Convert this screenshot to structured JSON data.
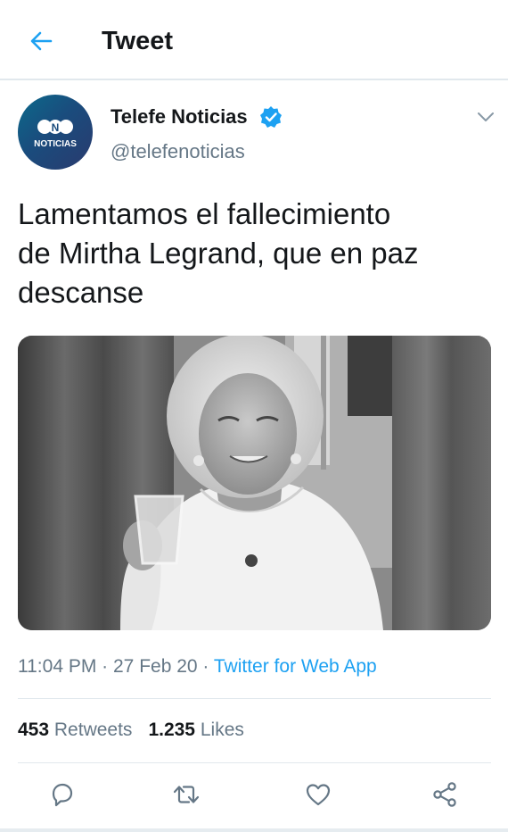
{
  "header": {
    "title": "Tweet",
    "back_icon": "arrow-left-icon",
    "accent_color": "#1da1f2"
  },
  "author": {
    "name": "Telefe Noticias",
    "handle": "@telefenoticias",
    "avatar_label": "NOTICIAS",
    "avatar_mark": "N",
    "verified": true
  },
  "tweet": {
    "text_lines": [
      "Lamentamos el fallecimiento",
      "de Mirtha Legrand, que en paz",
      "descanse"
    ]
  },
  "meta": {
    "time": "11:04 PM",
    "separator": " · ",
    "date": "27 Feb 20",
    "source": "Twitter for Web App"
  },
  "stats": {
    "retweets_count": "453",
    "retweets_label": "Retweets",
    "likes_count": "1.235",
    "likes_label": "Likes"
  },
  "actions": [
    "reply-icon",
    "retweet-icon",
    "like-icon",
    "share-icon"
  ],
  "colors": {
    "text": "#14171a",
    "secondary": "#657786",
    "link": "#1da1f2",
    "divider": "#e1e8ed"
  }
}
